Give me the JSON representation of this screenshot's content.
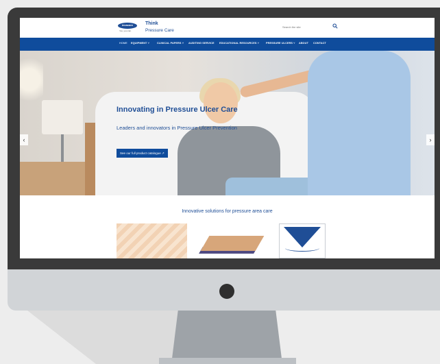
{
  "site": {
    "brand_line1": "Think",
    "brand_line2": "Pressure Care",
    "logo_text": "invacare",
    "logo_tagline": "Yes, you can."
  },
  "search": {
    "placeholder": "Search the site"
  },
  "nav": {
    "items": [
      {
        "label": "HOME",
        "active": true
      },
      {
        "label": "EQUIPMENT ˅"
      },
      {
        "label": "CLINICAL PAPERS ˅"
      },
      {
        "label": "AUDITING SERVICE"
      },
      {
        "label": "EDUCATIONAL RESOURCES ˅"
      },
      {
        "label": "PRESSURE ULCERS ˅"
      },
      {
        "label": "ABOUT"
      },
      {
        "label": "CONTACT"
      }
    ]
  },
  "hero": {
    "title": "Innovating in Pressure Ulcer Care",
    "subtitle": "Leaders and innovators in Pressure Ulcer Prevention",
    "cta_label": "See our full product catalogue ↗",
    "prev_arrow": "‹",
    "next_arrow": "›"
  },
  "section": {
    "title": "Innovative solutions for pressure area care"
  },
  "colors": {
    "brand_blue": "#0f4c9c",
    "bezel": "#3a3a3a",
    "chin": "#d1d4d7",
    "stand": "#9ea3a8"
  }
}
